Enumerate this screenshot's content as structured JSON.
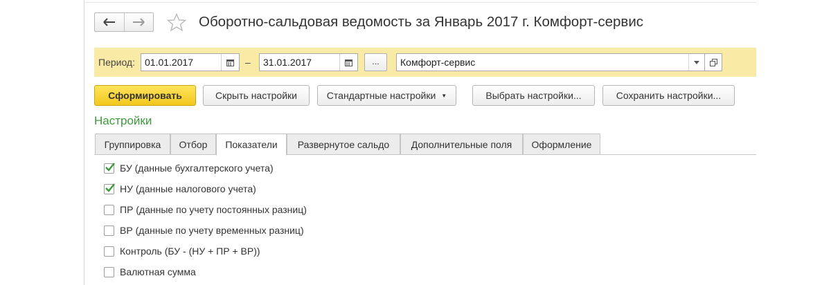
{
  "window": {
    "title": "Оборотно-сальдовая ведомость за Январь 2017 г. Комфорт-сервис"
  },
  "period": {
    "label": "Период:",
    "start": "01.01.2017",
    "separator": "–",
    "end": "31.01.2017",
    "more_label": "...",
    "organization": "Комфорт-сервис"
  },
  "toolbar": {
    "generate": "Сформировать",
    "hide_settings": "Скрыть настройки",
    "standard_settings": "Стандартные настройки",
    "choose_settings": "Выбрать настройки...",
    "save_settings": "Сохранить настройки..."
  },
  "settings": {
    "title": "Настройки",
    "tabs": [
      {
        "label": "Группировка"
      },
      {
        "label": "Отбор"
      },
      {
        "label": "Показатели"
      },
      {
        "label": "Развернутое сальдо"
      },
      {
        "label": "Дополнительные поля"
      },
      {
        "label": "Оформление"
      }
    ],
    "active_tab": "Показатели",
    "indicators": [
      {
        "label": "БУ (данные бухгалтерского учета)",
        "checked": true
      },
      {
        "label": "НУ (данные налогового учета)",
        "checked": true
      },
      {
        "label": "ПР (данные по учету постоянных разниц)",
        "checked": false
      },
      {
        "label": "ВР (данные по учету временных разниц)",
        "checked": false
      },
      {
        "label": "Контроль (БУ - (НУ + ПР + ВР))",
        "checked": false
      },
      {
        "label": "Валютная сумма",
        "checked": false
      }
    ]
  },
  "colors": {
    "period_bar": "#f9eaa6",
    "primary_button": "#f2c81e",
    "section_title": "#3e9a3e",
    "checkmark": "#3a9a3a"
  }
}
